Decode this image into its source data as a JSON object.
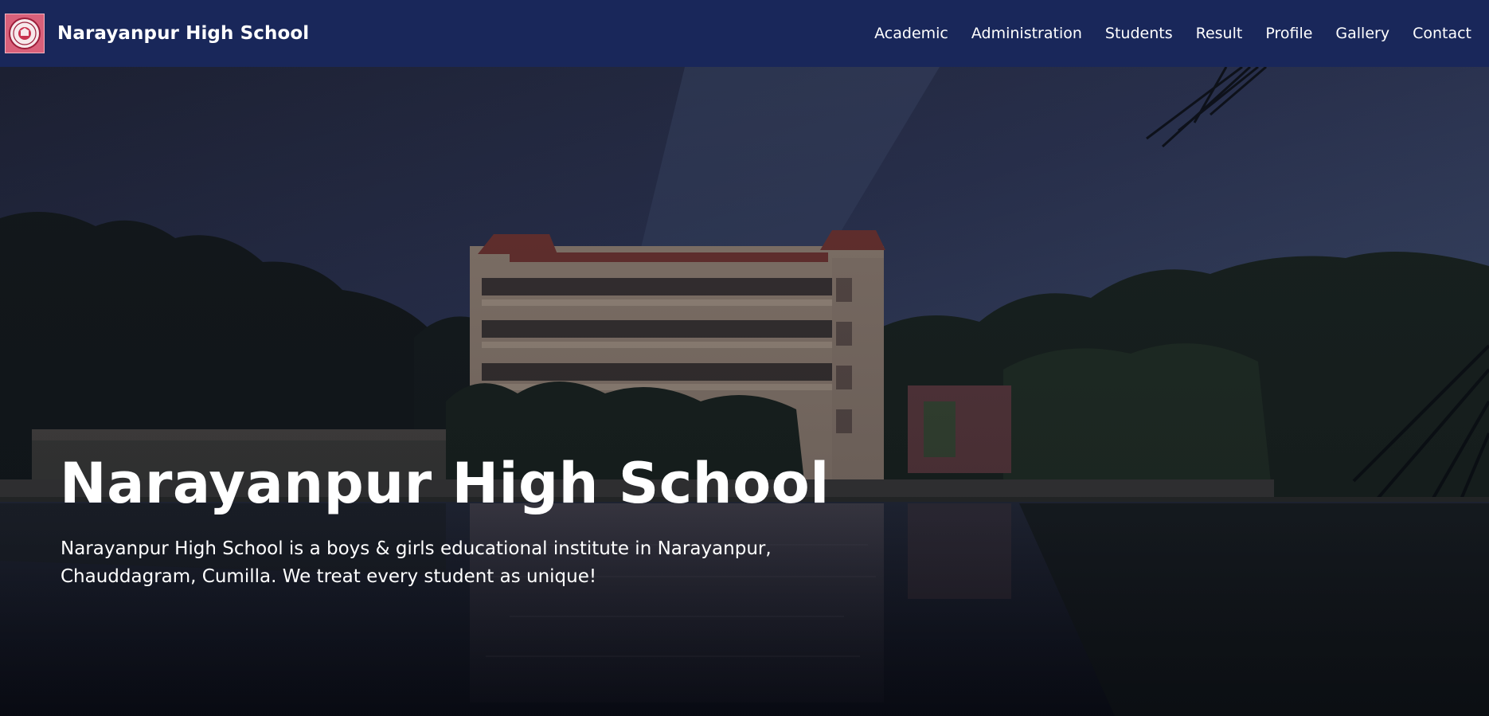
{
  "navbar": {
    "brand": {
      "name": "Narayanpur High School",
      "logo_icon": "school-crest-icon",
      "logo_color": "#d9607a"
    },
    "background_color": "#19275a",
    "items": [
      {
        "label": "Academic"
      },
      {
        "label": "Administration"
      },
      {
        "label": "Students"
      },
      {
        "label": "Result"
      },
      {
        "label": "Profile"
      },
      {
        "label": "Gallery"
      },
      {
        "label": "Contact"
      }
    ]
  },
  "hero": {
    "title": "Narayanpur High School",
    "description": "Narayanpur High School is a boys & girls educational institute in Narayanpur, Chauddagram, Cumilla. We treat every student as unique!",
    "background_image": "school-building-by-pond-photo"
  }
}
